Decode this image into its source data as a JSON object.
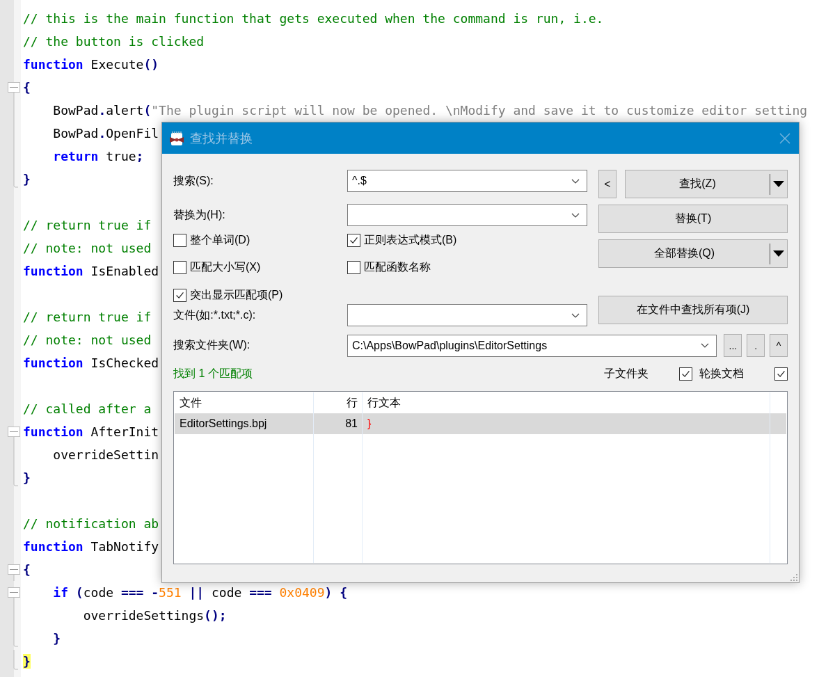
{
  "editor": {
    "lines": [
      {
        "kind": "code",
        "tokens": [
          {
            "kind": "comment",
            "text": "// this is the main function that gets executed when the command is run, i.e."
          }
        ]
      },
      {
        "kind": "code",
        "tokens": [
          {
            "kind": "comment",
            "text": "// the button is clicked"
          }
        ]
      },
      {
        "kind": "code",
        "tokens": [
          {
            "kind": "keyword",
            "text": "function"
          },
          {
            "kind": "plain",
            "text": " Execute"
          },
          {
            "kind": "op",
            "text": "()"
          }
        ]
      },
      {
        "kind": "fold",
        "children": [
          {
            "kind": "code",
            "tokens": [
              {
                "kind": "op",
                "text": "{"
              }
            ]
          },
          {
            "kind": "code",
            "tokens": [
              {
                "kind": "plain",
                "text": "    BowPad"
              },
              {
                "kind": "op",
                "text": "."
              },
              {
                "kind": "plain",
                "text": "alert"
              },
              {
                "kind": "op",
                "text": "("
              },
              {
                "kind": "string",
                "text": "\"The plugin script will now be opened. \\nModify and save it to customize editor setting"
              }
            ]
          },
          {
            "kind": "code",
            "tokens": [
              {
                "kind": "plain",
                "text": "    BowPad"
              },
              {
                "kind": "op",
                "text": "."
              },
              {
                "kind": "plain",
                "text": "OpenFil"
              }
            ]
          },
          {
            "kind": "code",
            "tokens": [
              {
                "kind": "keyword",
                "text": "    return"
              },
              {
                "kind": "plain",
                "text": " true"
              },
              {
                "kind": "op",
                "text": ";"
              }
            ]
          },
          {
            "kind": "code",
            "tokens": [
              {
                "kind": "op",
                "text": "}"
              }
            ]
          }
        ]
      },
      {
        "kind": "blank"
      },
      {
        "kind": "code",
        "tokens": [
          {
            "kind": "comment",
            "text": "// return true if"
          }
        ]
      },
      {
        "kind": "code",
        "tokens": [
          {
            "kind": "comment",
            "text": "// note: not used"
          }
        ]
      },
      {
        "kind": "code",
        "tokens": [
          {
            "kind": "keyword",
            "text": "function"
          },
          {
            "kind": "plain",
            "text": " IsEnabled"
          }
        ]
      },
      {
        "kind": "blank"
      },
      {
        "kind": "code",
        "tokens": [
          {
            "kind": "comment",
            "text": "// return true if"
          }
        ]
      },
      {
        "kind": "code",
        "tokens": [
          {
            "kind": "comment",
            "text": "// note: not used"
          }
        ]
      },
      {
        "kind": "code",
        "tokens": [
          {
            "kind": "keyword",
            "text": "function"
          },
          {
            "kind": "plain",
            "text": " IsChecked"
          }
        ]
      },
      {
        "kind": "blank"
      },
      {
        "kind": "code",
        "tokens": [
          {
            "kind": "comment",
            "text": "// called after a"
          }
        ]
      },
      {
        "kind": "fold",
        "children": [
          {
            "kind": "code",
            "tokens": [
              {
                "kind": "keyword",
                "text": "function"
              },
              {
                "kind": "plain",
                "text": " AfterInit"
              }
            ]
          },
          {
            "kind": "code",
            "tokens": [
              {
                "kind": "plain",
                "text": "    overrideSettin"
              }
            ]
          },
          {
            "kind": "code",
            "tokens": [
              {
                "kind": "op",
                "text": "}"
              }
            ]
          }
        ]
      },
      {
        "kind": "blank"
      },
      {
        "kind": "code",
        "tokens": [
          {
            "kind": "comment",
            "text": "// notification ab"
          }
        ]
      },
      {
        "kind": "code",
        "tokens": [
          {
            "kind": "keyword",
            "text": "function"
          },
          {
            "kind": "plain",
            "text": " TabNotify"
          }
        ]
      },
      {
        "kind": "fold",
        "children": [
          {
            "kind": "code",
            "tokens": [
              {
                "kind": "op",
                "text": "{"
              }
            ]
          },
          {
            "kind": "fold",
            "children": [
              {
                "kind": "code",
                "tokens": [
                  {
                    "kind": "keyword",
                    "text": "    if"
                  },
                  {
                    "kind": "op",
                    "text": " ("
                  },
                  {
                    "kind": "plain",
                    "text": "code "
                  },
                  {
                    "kind": "op",
                    "text": "=== -"
                  },
                  {
                    "kind": "number",
                    "text": "551"
                  },
                  {
                    "kind": "op",
                    "text": " || "
                  },
                  {
                    "kind": "plain",
                    "text": "code "
                  },
                  {
                    "kind": "op",
                    "text": "=== "
                  },
                  {
                    "kind": "number",
                    "text": "0x0409"
                  },
                  {
                    "kind": "op",
                    "text": ") {"
                  }
                ]
              },
              {
                "kind": "code",
                "tokens": [
                  {
                    "kind": "plain",
                    "text": "        overrideSettings"
                  },
                  {
                    "kind": "op",
                    "text": "();"
                  }
                ]
              },
              {
                "kind": "code",
                "tokens": [
                  {
                    "kind": "op",
                    "text": "    }"
                  }
                ]
              }
            ]
          },
          {
            "kind": "code",
            "tokens": [
              {
                "kind": "match",
                "text": "}"
              }
            ]
          }
        ]
      }
    ]
  },
  "dialog": {
    "title": "查找并替换",
    "search": {
      "label": "搜索(S):",
      "value": "^.$"
    },
    "replace": {
      "label": "替换为(H):"
    },
    "options": [
      {
        "label": "整个单词(D)",
        "checked": false
      },
      {
        "label": "正则表达式模式(B)",
        "checked": true
      },
      {
        "label": "匹配大小写(X)",
        "checked": false
      },
      {
        "label": "匹配函数名称",
        "checked": false
      },
      {
        "label": "突出显示匹配项(P)",
        "checked": true
      }
    ],
    "file_filter": {
      "label": "文件(如:*.txt;*.c):"
    },
    "folder": {
      "label": "搜索文件夹(W):",
      "value": "C:\\Apps\\BowPad\\plugins\\EditorSettings"
    },
    "buttons": {
      "previous": "<",
      "find": "查找(Z)",
      "replace": "替换(T)",
      "replace_all": "全部替换(Q)",
      "find_all": "在文件中查找所有项(J)"
    },
    "folder_buttons": [
      "...",
      ".",
      "^"
    ],
    "status": "找到 1 个匹配项",
    "toggles": [
      {
        "label": "子文件夹",
        "checked": true
      },
      {
        "label": "轮换文档",
        "checked": true
      }
    ],
    "results": {
      "columns": [
        "文件",
        "行",
        "行文本"
      ],
      "rows": [
        {
          "cells": [
            "EditorSettings.bpj",
            "81",
            "}"
          ],
          "selected": true
        }
      ]
    }
  }
}
